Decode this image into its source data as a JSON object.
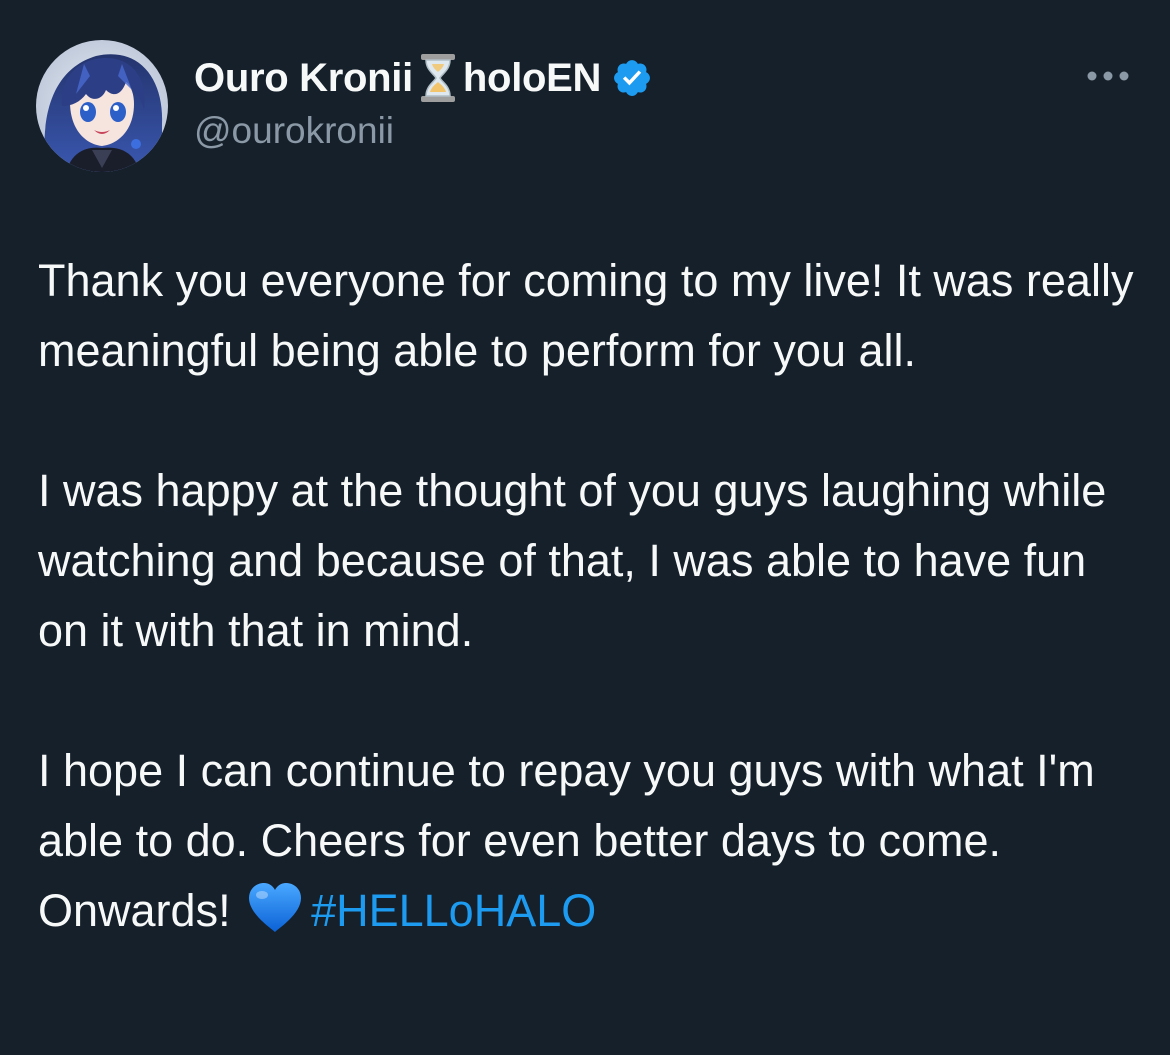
{
  "author": {
    "name_part1": "Ouro Kronii",
    "name_emoji": "hourglass-icon",
    "name_part2": "holoEN",
    "verified_badge": "verified-icon",
    "handle": "@ourokronii",
    "avatar": "avatar"
  },
  "menu": {
    "more_icon": "more-icon"
  },
  "tweet": {
    "paragraph1": "Thank you everyone for coming to my live! It was really meaningful being able to perform for you all.",
    "paragraph2": "I was happy at the thought of you guys laughing while watching and because of that, I was able to have fun on it with that in mind.",
    "paragraph3_text": "I hope I can continue to repay you guys with what I'm able to do. Cheers for even better days to come. Onwards!",
    "paragraph3_emoji": "blue-heart-icon",
    "hashtag": "#HELLoHALO"
  },
  "colors": {
    "background": "#15202b",
    "text": "#f7f9f9",
    "secondary_text": "#8b98a5",
    "accent": "#1d9bf0"
  }
}
